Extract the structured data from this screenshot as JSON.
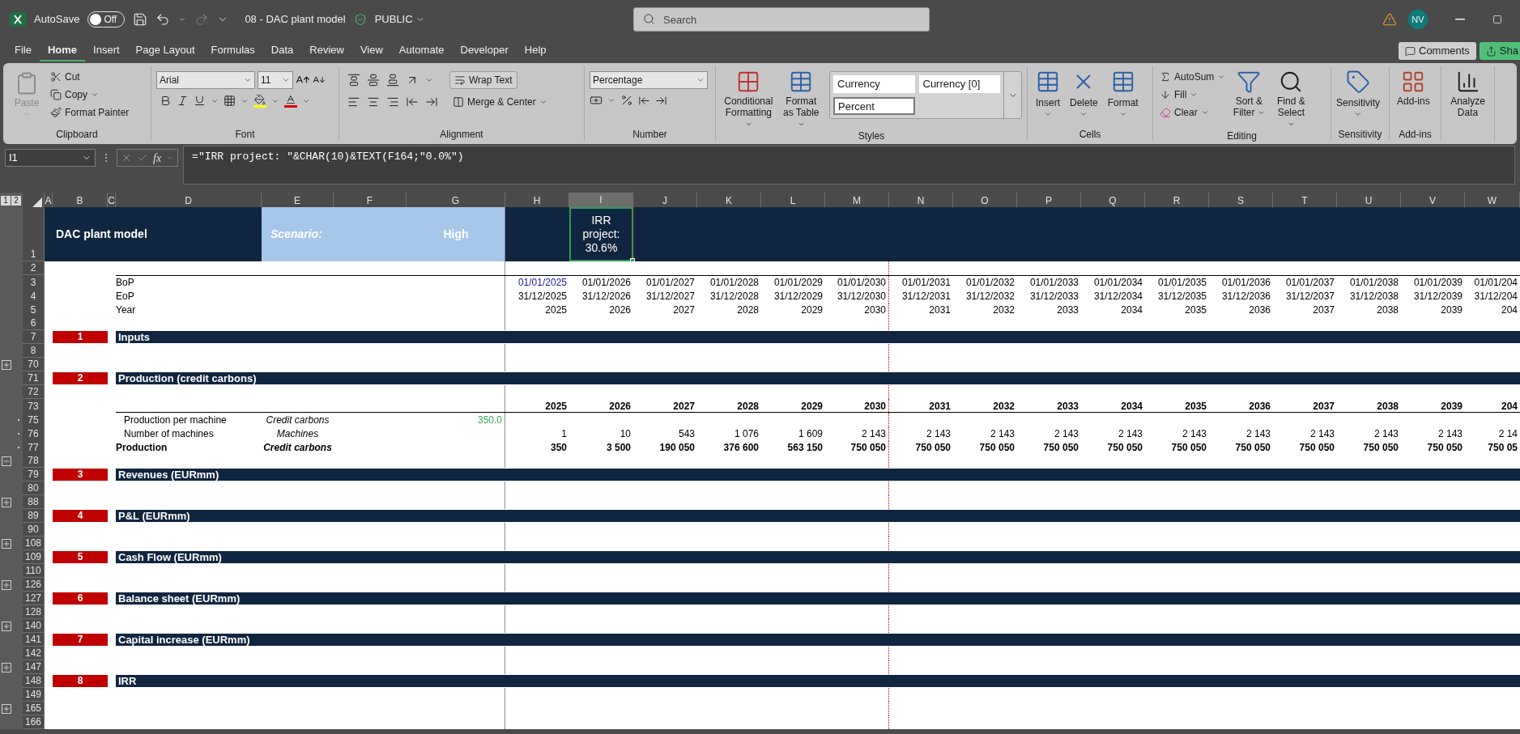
{
  "title_bar": {
    "autosave": {
      "label": "AutoSave",
      "on": false,
      "state": "Off"
    },
    "file_name": "08 - DAC plant model",
    "sensitivity": "PUBLIC",
    "search": {
      "placeholder": "Search"
    },
    "avatar": "NV"
  },
  "menu": {
    "tabs": [
      {
        "label": "File",
        "selected": false
      },
      {
        "label": "Home",
        "selected": true
      },
      {
        "label": "Insert",
        "selected": false
      },
      {
        "label": "Page Layout",
        "selected": false
      },
      {
        "label": "Formulas",
        "selected": false
      },
      {
        "label": "Data",
        "selected": false
      },
      {
        "label": "Review",
        "selected": false
      },
      {
        "label": "View",
        "selected": false
      },
      {
        "label": "Automate",
        "selected": false
      },
      {
        "label": "Developer",
        "selected": false
      },
      {
        "label": "Help",
        "selected": false
      }
    ],
    "buttons": [
      "Comments",
      "Sha"
    ]
  },
  "ribbon": {
    "groups": [
      {
        "kind": "clipboard",
        "label": "Clipboard",
        "paste": "Paste",
        "paste_disabled": true,
        "items": [
          "Cut",
          "Copy",
          "Format Painter"
        ]
      },
      {
        "kind": "font",
        "label": "Font",
        "font": "Arial",
        "size": "11"
      },
      {
        "kind": "alignment",
        "label": "Alignment",
        "wrap": "Wrap Text",
        "merge": "Merge & Center"
      },
      {
        "kind": "number",
        "label": "Number",
        "format": "Percentage"
      },
      {
        "kind": "styles",
        "label": "Styles",
        "buttons": [
          "Conditional Formatting",
          "Format as Table"
        ],
        "styles": [
          {
            "label": "Currency",
            "selected": false
          },
          {
            "label": "Currency [0]",
            "selected": false
          },
          {
            "label": "Percent",
            "selected": true
          }
        ]
      },
      {
        "kind": "cells",
        "label": "Cells",
        "buttons": [
          "Insert",
          "Delete",
          "Format"
        ]
      },
      {
        "kind": "editing",
        "label": "Editing",
        "small": [
          "AutoSum",
          "Fill",
          "Clear"
        ],
        "buttons": [
          "Sort & Filter",
          "Find & Select"
        ]
      },
      {
        "kind": "sensitivity",
        "label": "Sensitivity",
        "buttons": [
          "Sensitivity"
        ]
      },
      {
        "kind": "addins",
        "label": "Add-ins",
        "buttons": [
          "Add-ins"
        ]
      },
      {
        "kind": "analyze",
        "buttons": [
          "Analyze Data"
        ]
      }
    ]
  },
  "formula_bar": {
    "name_box": "I1",
    "fx": "fx",
    "formula": "=\"IRR project: \"&CHAR(10)&TEXT(F164;\"0.0%\")"
  },
  "sheet": {
    "outline_levels": [
      "1",
      "2"
    ],
    "columns": [
      {
        "label": "A",
        "selected": false
      },
      {
        "label": "B",
        "selected": false
      },
      {
        "label": "C",
        "selected": false
      },
      {
        "label": "D",
        "selected": false
      },
      {
        "label": "E",
        "selected": false
      },
      {
        "label": "F",
        "selected": false
      },
      {
        "label": "G",
        "selected": false
      },
      {
        "label": "H",
        "selected": false
      },
      {
        "label": "I",
        "selected": true
      },
      {
        "label": "J",
        "selected": false
      },
      {
        "label": "K",
        "selected": false
      },
      {
        "label": "L",
        "selected": false
      },
      {
        "label": "M",
        "selected": false
      },
      {
        "label": "N",
        "selected": false
      },
      {
        "label": "O",
        "selected": false
      },
      {
        "label": "P",
        "selected": false
      },
      {
        "label": "Q",
        "selected": false
      },
      {
        "label": "R",
        "selected": false
      },
      {
        "label": "S",
        "selected": false
      },
      {
        "label": "T",
        "selected": false
      },
      {
        "label": "U",
        "selected": false
      },
      {
        "label": "V",
        "selected": false
      },
      {
        "label": "W",
        "selected": false
      }
    ],
    "title_row": {
      "num": "1",
      "title": "DAC plant model",
      "scenario_label": "Scenario:",
      "scenario_value": "High",
      "irr": "IRR\nproject:\n30.6%"
    },
    "rows": [
      {
        "num": "2",
        "kind": "blank"
      },
      {
        "num": "3",
        "kind": "period",
        "rule_above": true,
        "first_is_input": true,
        "label": "BoP",
        "values": [
          "01/01/2025",
          "01/01/2026",
          "01/01/2027",
          "01/01/2028",
          "01/01/2029",
          "01/01/2030",
          "01/01/2031",
          "01/01/2032",
          "01/01/2033",
          "01/01/2034",
          "01/01/2035",
          "01/01/2036",
          "01/01/2037",
          "01/01/2038",
          "01/01/2039",
          "01/01/204"
        ]
      },
      {
        "num": "4",
        "kind": "period",
        "rule_above": false,
        "first_is_input": false,
        "label": "EoP",
        "values": [
          "31/12/2025",
          "31/12/2026",
          "31/12/2027",
          "31/12/2028",
          "31/12/2029",
          "31/12/2030",
          "31/12/2031",
          "31/12/2032",
          "31/12/2033",
          "31/12/2034",
          "31/12/2035",
          "31/12/2036",
          "31/12/2037",
          "31/12/2038",
          "31/12/2039",
          "31/12/204"
        ]
      },
      {
        "num": "5",
        "kind": "period",
        "rule_above": false,
        "first_is_input": false,
        "label": "Year",
        "values": [
          "2025",
          "2026",
          "2027",
          "2028",
          "2029",
          "2030",
          "2031",
          "2032",
          "2033",
          "2034",
          "2035",
          "2036",
          "2037",
          "2038",
          "2039",
          "204"
        ]
      },
      {
        "num": "6",
        "kind": "blank"
      },
      {
        "num": "7",
        "kind": "section",
        "badge": "1",
        "title": "Inputs"
      },
      {
        "num": "8",
        "kind": "blank"
      },
      {
        "num": "70",
        "kind": "blank",
        "outline": {
          "kind": "collapsed"
        }
      },
      {
        "num": "71",
        "kind": "section",
        "badge": "2",
        "title": "Production (credit carbons)"
      },
      {
        "num": "72",
        "kind": "blank"
      },
      {
        "num": "73",
        "kind": "years",
        "values": [
          "2025",
          "2026",
          "2027",
          "2028",
          "2029",
          "2030",
          "2031",
          "2032",
          "2033",
          "2034",
          "2035",
          "2036",
          "2037",
          "2038",
          "2039",
          "204"
        ]
      },
      {
        "num": "75",
        "kind": "line",
        "outline": {
          "kind": "member"
        },
        "bold": false,
        "label": "Production per machine",
        "unit": "Credit carbons",
        "input": "350.0"
      },
      {
        "num": "76",
        "kind": "line",
        "outline": {
          "kind": "member"
        },
        "bold": false,
        "label": "Number of machines",
        "unit": "Machines",
        "values": [
          "1",
          "10",
          "543",
          "1 076",
          "1 609",
          "2 143",
          "2 143",
          "2 143",
          "2 143",
          "2 143",
          "2 143",
          "2 143",
          "2 143",
          "2 143",
          "2 143",
          "2 14"
        ]
      },
      {
        "num": "77",
        "kind": "line",
        "outline": {
          "kind": "member"
        },
        "bold": true,
        "label": "Production",
        "unit": "Credit carbons",
        "values": [
          "350",
          "3 500",
          "190 050",
          "376 600",
          "563 150",
          "750 050",
          "750 050",
          "750 050",
          "750 050",
          "750 050",
          "750 050",
          "750 050",
          "750 050",
          "750 050",
          "750 050",
          "750 05"
        ]
      },
      {
        "num": "78",
        "kind": "blank",
        "outline": {
          "kind": "expanded"
        }
      },
      {
        "num": "79",
        "kind": "section",
        "badge": "3",
        "title": "Revenues (EURmm)"
      },
      {
        "num": "80",
        "kind": "blank"
      },
      {
        "num": "88",
        "kind": "blank",
        "outline": {
          "kind": "collapsed"
        }
      },
      {
        "num": "89",
        "kind": "section",
        "badge": "4",
        "title": "P&L (EURmm)"
      },
      {
        "num": "90",
        "kind": "blank"
      },
      {
        "num": "108",
        "kind": "blank",
        "outline": {
          "kind": "collapsed"
        }
      },
      {
        "num": "109",
        "kind": "section",
        "badge": "5",
        "title": "Cash Flow (EURmm)"
      },
      {
        "num": "110",
        "kind": "blank"
      },
      {
        "num": "126",
        "kind": "blank",
        "outline": {
          "kind": "collapsed"
        }
      },
      {
        "num": "127",
        "kind": "section",
        "badge": "6",
        "title": "Balance sheet (EURmm)"
      },
      {
        "num": "128",
        "kind": "blank"
      },
      {
        "num": "140",
        "kind": "blank",
        "outline": {
          "kind": "collapsed"
        }
      },
      {
        "num": "141",
        "kind": "section",
        "badge": "7",
        "title": "Capital increase (EURmm)"
      },
      {
        "num": "142",
        "kind": "blank"
      },
      {
        "num": "147",
        "kind": "blank",
        "outline": {
          "kind": "collapsed"
        }
      },
      {
        "num": "148",
        "kind": "section",
        "badge": "8",
        "title": "IRR"
      },
      {
        "num": "149",
        "kind": "blank"
      },
      {
        "num": "165",
        "kind": "blank",
        "outline": {
          "kind": "collapsed"
        }
      },
      {
        "num": "166",
        "kind": "blank"
      }
    ]
  }
}
